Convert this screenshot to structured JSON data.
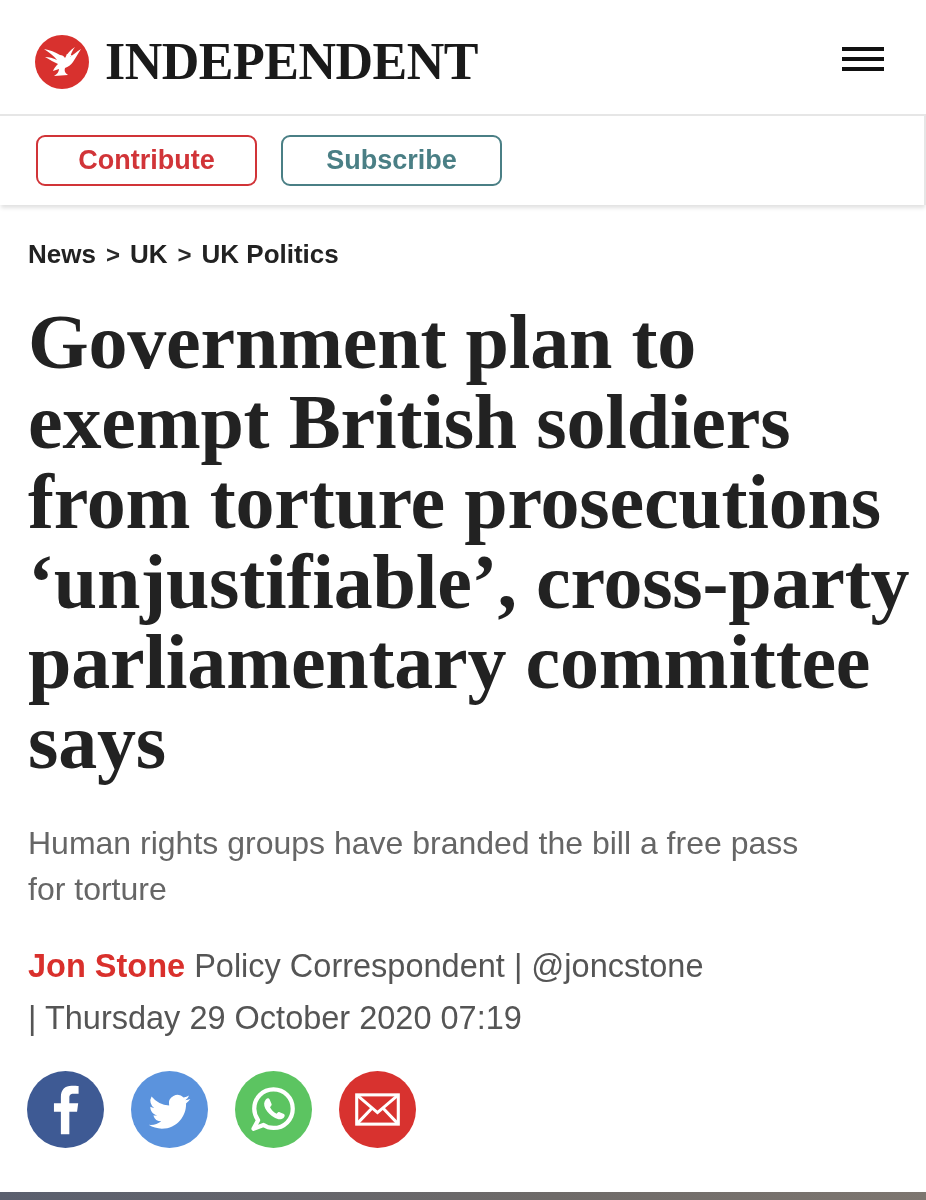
{
  "header": {
    "brand": "INDEPENDENT"
  },
  "actions": [
    {
      "label": "Contribute",
      "color": "#d13438"
    },
    {
      "label": "Subscribe",
      "color": "#4a7f85"
    }
  ],
  "breadcrumb": [
    {
      "kind": "link",
      "text": "News"
    },
    {
      "kind": "separator",
      "text": ">"
    },
    {
      "kind": "link",
      "text": "UK"
    },
    {
      "kind": "separator",
      "text": ">"
    },
    {
      "kind": "link",
      "text": "UK Politics"
    }
  ],
  "article": {
    "headline": "Government plan to exempt British soldiers from torture prosecutions ‘unjustifiable’, cross-party parliamentary committee says",
    "standfirst": "Human rights groups have branded the bill a free pass for torture",
    "byline": [
      {
        "kind": "author",
        "text": "Jon Stone"
      },
      {
        "kind": "role",
        "text": "Policy Correspondent"
      },
      {
        "kind": "separator",
        "text": "|"
      },
      {
        "kind": "handle",
        "text": "@joncstone"
      },
      {
        "kind": "separator",
        "text": "|"
      },
      {
        "kind": "date",
        "text": "Thursday 29 October 2020 07:19"
      }
    ]
  },
  "share_buttons": [
    {
      "kind": "facebook"
    },
    {
      "kind": "twitter"
    },
    {
      "kind": "whatsapp"
    },
    {
      "kind": "email"
    }
  ]
}
